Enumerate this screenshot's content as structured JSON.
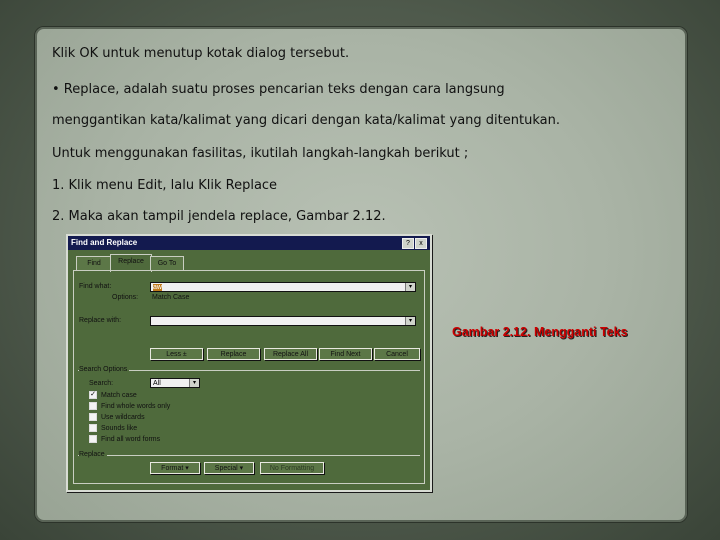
{
  "slide": {
    "lines": [
      "Klik OK untuk menutup kotak dialog tersebut.",
      "• Replace, adalah suatu proses pencarian teks dengan cara langsung",
      "menggantikan kata/kalimat yang dicari dengan kata/kalimat yang ditentukan.",
      "Untuk menggunakan fasilitas, ikutilah langkah-langkah berikut ;",
      "1. Klik menu Edit, lalu Klik Replace",
      "2. Maka akan tampil jendela replace, Gambar 2.12."
    ],
    "caption": "Gambar 2.12. Mengganti Teks",
    "caption_color": "#cc0000"
  },
  "dialog": {
    "title": "Find and Replace",
    "help_label": "?",
    "close_label": "x",
    "tabs": [
      "Find",
      "Replace",
      "Go To"
    ],
    "find_label": "Find what:",
    "find_value": "aw",
    "options_label": "Options:",
    "options_value": "Match Case",
    "replace_label": "Replace with:",
    "replace_value": "",
    "buttons": [
      "Less ±",
      "Replace",
      "Replace All",
      "Find Next",
      "Cancel"
    ],
    "search_options_label": "Search Options",
    "search_label": "Search:",
    "search_value": "All",
    "checkboxes": [
      {
        "label": "Match case",
        "checked": "✓"
      },
      {
        "label": "Find whole words only",
        "checked": ""
      },
      {
        "label": "Use wildcards",
        "checked": ""
      },
      {
        "label": "Sounds like",
        "checked": ""
      },
      {
        "label": "Find all word forms",
        "checked": ""
      }
    ],
    "replace_group_label": "Replace",
    "bottom_buttons": [
      "Format ▾",
      "Special ▾",
      "No Formatting"
    ],
    "arrow_glyph": "▾"
  }
}
